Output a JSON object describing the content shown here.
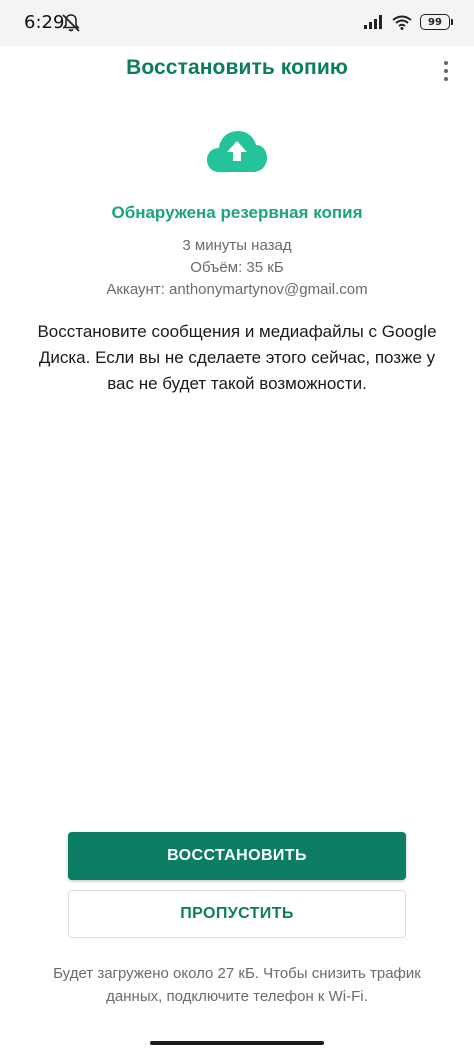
{
  "status_bar": {
    "time": "6:29",
    "battery": "99",
    "icons": [
      "mute-icon",
      "signal-icon",
      "wifi-icon",
      "battery-icon"
    ]
  },
  "header": {
    "title": "Восстановить копию",
    "menu_icon": "more-vert-icon"
  },
  "backup": {
    "icon": "cloud-upload-icon",
    "title": "Обнаружена резервная копия",
    "time": "3 минуты назад",
    "size": "Объём: 35 кБ",
    "account": "Аккаунт: anthonymartynov@gmail.com"
  },
  "description": "Восстановите сообщения и медиафайлы с Google Диска. Если вы не сделаете этого сейчас, позже у вас не будет такой возможности.",
  "buttons": {
    "restore": "ВОССТАНОВИТЬ",
    "skip": "ПРОПУСТИТЬ"
  },
  "footnote": "Будет загружено около 27 кБ. Чтобы снизить трафик данных, подключите телефон к Wi-Fi.",
  "colors": {
    "accent": "#0b7d62",
    "accent_light": "#18a57f",
    "cloud": "#25c39a"
  }
}
